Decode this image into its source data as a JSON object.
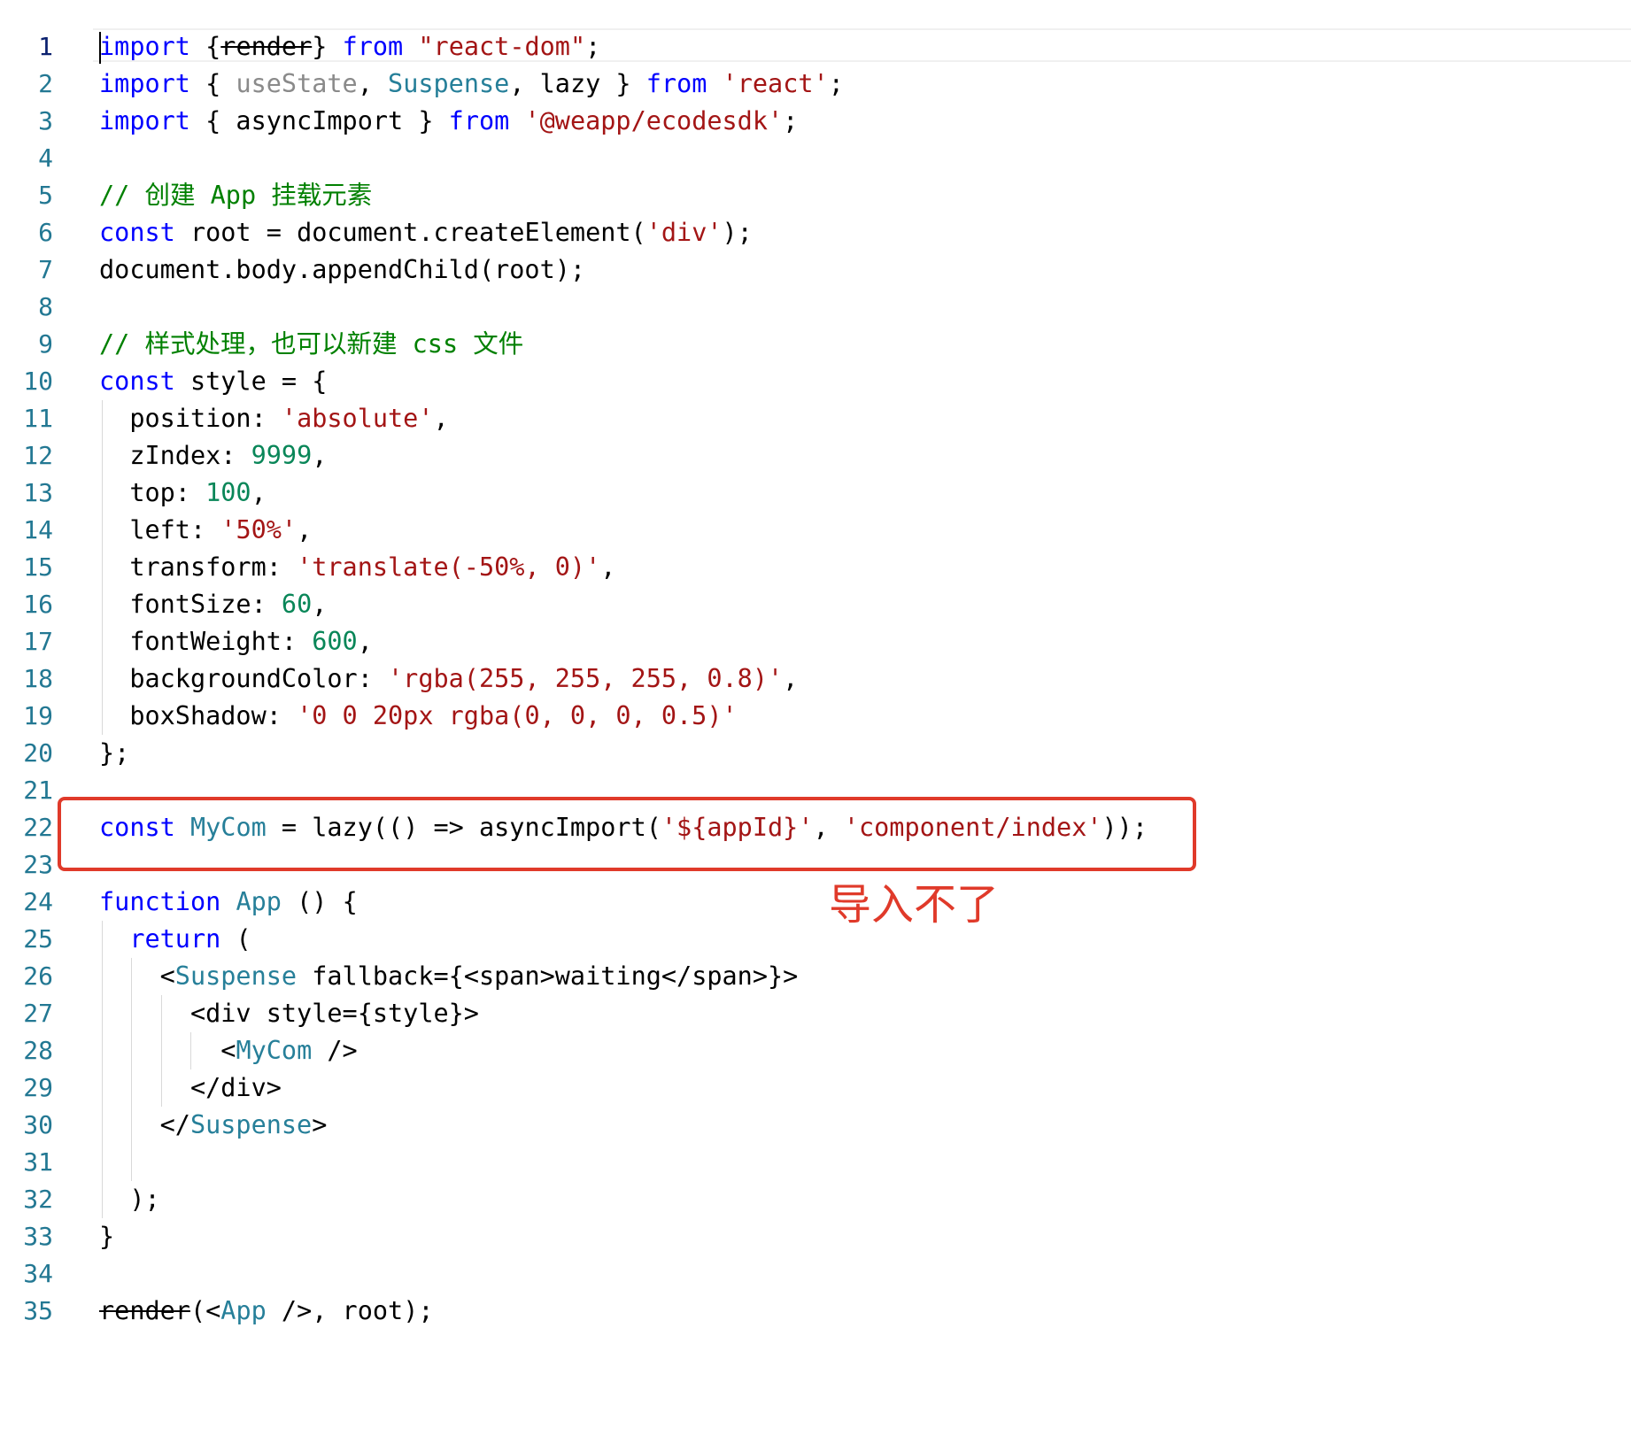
{
  "line_numbers": [
    "1",
    "2",
    "3",
    "4",
    "5",
    "6",
    "7",
    "8",
    "9",
    "10",
    "11",
    "12",
    "13",
    "14",
    "15",
    "16",
    "17",
    "18",
    "19",
    "20",
    "21",
    "22",
    "23",
    "24",
    "25",
    "26",
    "27",
    "28",
    "29",
    "30",
    "31",
    "32",
    "33",
    "34",
    "35"
  ],
  "tokens": {
    "l1": [
      "import",
      " {",
      "render",
      "} ",
      "from",
      " ",
      "\"react-dom\"",
      ";"
    ],
    "l2": [
      "import",
      " { ",
      "useState",
      ", ",
      "Suspense",
      ", lazy } ",
      "from",
      " ",
      "'react'",
      ";"
    ],
    "l3": [
      "import",
      " { asyncImport } ",
      "from",
      " ",
      "'@weapp/ecodesdk'",
      ";"
    ],
    "l5": [
      "// 创建 App 挂载元素"
    ],
    "l6": [
      "const",
      " root = document.createElement(",
      "'div'",
      ");"
    ],
    "l7": [
      "document.body.appendChild(root);"
    ],
    "l9": [
      "// 样式处理，也可以新建 css 文件"
    ],
    "l10": [
      "const",
      " style = {"
    ],
    "l11": [
      "  position: ",
      "'absolute'",
      ","
    ],
    "l12": [
      "  zIndex: ",
      "9999",
      ","
    ],
    "l13": [
      "  top: ",
      "100",
      ","
    ],
    "l14": [
      "  left: ",
      "'50%'",
      ","
    ],
    "l15": [
      "  transform: ",
      "'translate(-50%, 0)'",
      ","
    ],
    "l16": [
      "  fontSize: ",
      "60",
      ","
    ],
    "l17": [
      "  fontWeight: ",
      "600",
      ","
    ],
    "l18": [
      "  backgroundColor: ",
      "'rgba(255, 255, 255, 0.8)'",
      ","
    ],
    "l19": [
      "  boxShadow: ",
      "'0 0 20px rgba(0, 0, 0, 0.5)'"
    ],
    "l20": [
      "};"
    ],
    "l22": [
      "const",
      " ",
      "MyCom",
      " = lazy(() => asyncImport(",
      "'${appId}'",
      ", ",
      "'component/index'",
      "));"
    ],
    "l24": [
      "function",
      " ",
      "App",
      " () {"
    ],
    "l25": [
      "  ",
      "return",
      " ("
    ],
    "l26": [
      "    <",
      "Suspense",
      " fallback={<span>waiting</span>}>"
    ],
    "l27": [
      "      <div style={style}>"
    ],
    "l28": [
      "        <",
      "MyCom",
      " />"
    ],
    "l29": [
      "      </div>"
    ],
    "l30": [
      "    </",
      "Suspense",
      ">"
    ],
    "l32": [
      "  );"
    ],
    "l33": [
      "}"
    ],
    "l35": [
      "render",
      "(<",
      "App",
      " />, root);"
    ]
  },
  "annotation": {
    "text": "导入不了",
    "color": "#e03a2a"
  },
  "colors": {
    "keyword": "#0000ff",
    "string": "#a31515",
    "number": "#098658",
    "comment": "#008000",
    "type": "#267f99",
    "unused": "#8a8a8a",
    "line_number": "#237893"
  }
}
